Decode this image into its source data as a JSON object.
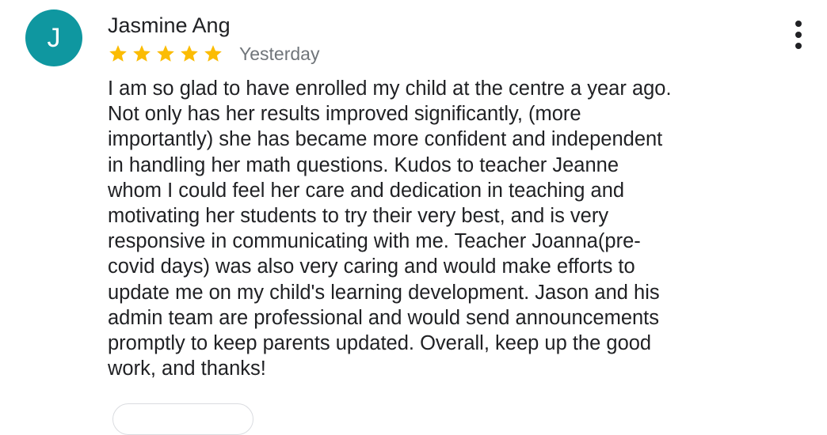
{
  "review": {
    "author": {
      "name": "Jasmine Ang",
      "avatar_initial": "J",
      "avatar_color": "#0f97a0"
    },
    "rating": {
      "stars": 5,
      "max_stars": 5,
      "star_color": "#fbbc04"
    },
    "date": "Yesterday",
    "more_options_icon": "more-vert-icon",
    "body_lines": [
      "I am so glad to have enrolled my child at the centre a year ago.",
      "Not only has her results improved significantly, (more",
      "importantly) she has became more confident and independent",
      "in handling her math questions. Kudos to teacher Jeanne",
      "whom I could feel her care and dedication in teaching and",
      "motivating her students to try their very best, and is very",
      "responsive in communicating with me. Teacher Joanna(pre-",
      "covid days) was also very caring and would make efforts to",
      "update me on my child's learning development. Jason and his",
      "admin team are professional and would send announcements",
      "promptly to keep parents updated. Overall, keep up the good",
      "work, and thanks!"
    ]
  }
}
